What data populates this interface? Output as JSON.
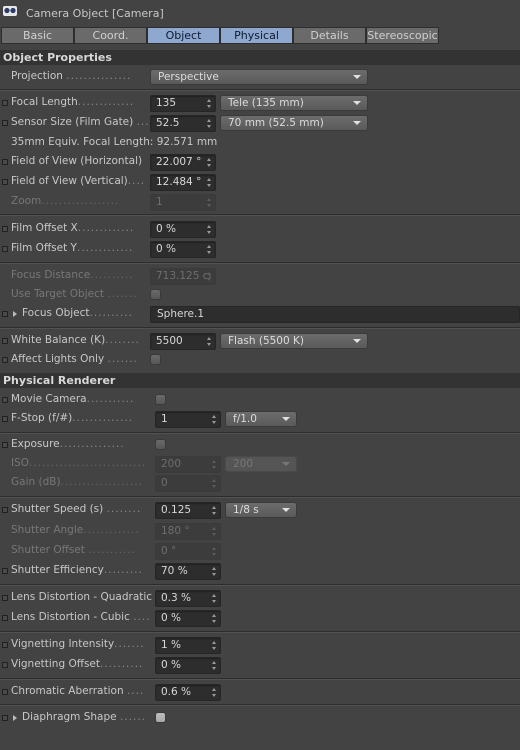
{
  "window": {
    "title": "Camera Object [Camera]",
    "icon": "camera-icon"
  },
  "tabs": [
    {
      "label": "Basic",
      "active": false
    },
    {
      "label": "Coord.",
      "active": false
    },
    {
      "label": "Object",
      "active": true
    },
    {
      "label": "Physical",
      "active": true
    },
    {
      "label": "Details",
      "active": false
    },
    {
      "label": "Stereoscopic",
      "active": false
    }
  ],
  "object_properties": {
    "header": "Object Properties",
    "projection": {
      "label": "Projection",
      "value": "Perspective"
    },
    "focal_length": {
      "label": "Focal Length",
      "value": "135",
      "preset": "Tele (135 mm)"
    },
    "sensor_size": {
      "label": "Sensor Size (Film Gate)",
      "value": "52.5",
      "preset": "70 mm (52.5 mm)"
    },
    "equiv_focal": "35mm Equiv. Focal Length: 92.571 mm",
    "fov_h": {
      "label": "Field of View (Horizontal)",
      "value": "22.007 °"
    },
    "fov_v": {
      "label": "Field of View (Vertical)",
      "value": "12.484 °"
    },
    "zoom": {
      "label": "Zoom",
      "value": "1"
    },
    "film_offset_x": {
      "label": "Film Offset X",
      "value": "0 %"
    },
    "film_offset_y": {
      "label": "Film Offset Y",
      "value": "0 %"
    },
    "focus_distance": {
      "label": "Focus Distance",
      "value": "713.125 cı"
    },
    "use_target_object": {
      "label": "Use Target Object",
      "checked": false
    },
    "focus_object": {
      "label": "Focus Object",
      "value": "Sphere.1"
    },
    "white_balance": {
      "label": "White Balance (K)",
      "value": "5500",
      "preset": "Flash (5500 K)"
    },
    "affect_lights_only": {
      "label": "Affect Lights Only",
      "checked": false
    }
  },
  "physical_renderer": {
    "header": "Physical Renderer",
    "movie_camera": {
      "label": "Movie Camera",
      "checked": false
    },
    "f_stop": {
      "label": "F-Stop (f/#)",
      "value": "1",
      "preset": "f/1.0"
    },
    "exposure": {
      "label": "Exposure",
      "checked": false
    },
    "iso": {
      "label": "ISO",
      "value": "200",
      "preset": "200"
    },
    "gain": {
      "label": "Gain (dB)",
      "value": "0"
    },
    "shutter_speed": {
      "label": "Shutter Speed (s)",
      "value": "0.125",
      "preset": "1/8 s"
    },
    "shutter_angle": {
      "label": "Shutter Angle",
      "value": "180 °"
    },
    "shutter_offset": {
      "label": "Shutter Offset",
      "value": "0 °"
    },
    "shutter_efficiency": {
      "label": "Shutter Efficiency",
      "value": "70 %"
    },
    "lens_quadratic": {
      "label": "Lens Distortion - Quadratic",
      "value": "0.3 %"
    },
    "lens_cubic": {
      "label": "Lens Distortion - Cubic",
      "value": "0 %"
    },
    "vignetting_intensity": {
      "label": "Vignetting Intensity",
      "value": "1 %"
    },
    "vignetting_offset": {
      "label": "Vignetting Offset",
      "value": "0 %"
    },
    "chromatic_aberration": {
      "label": "Chromatic Aberration",
      "value": "0.6 %"
    },
    "diaphragm_shape": {
      "label": "Diaphragm Shape",
      "checked": false
    }
  }
}
